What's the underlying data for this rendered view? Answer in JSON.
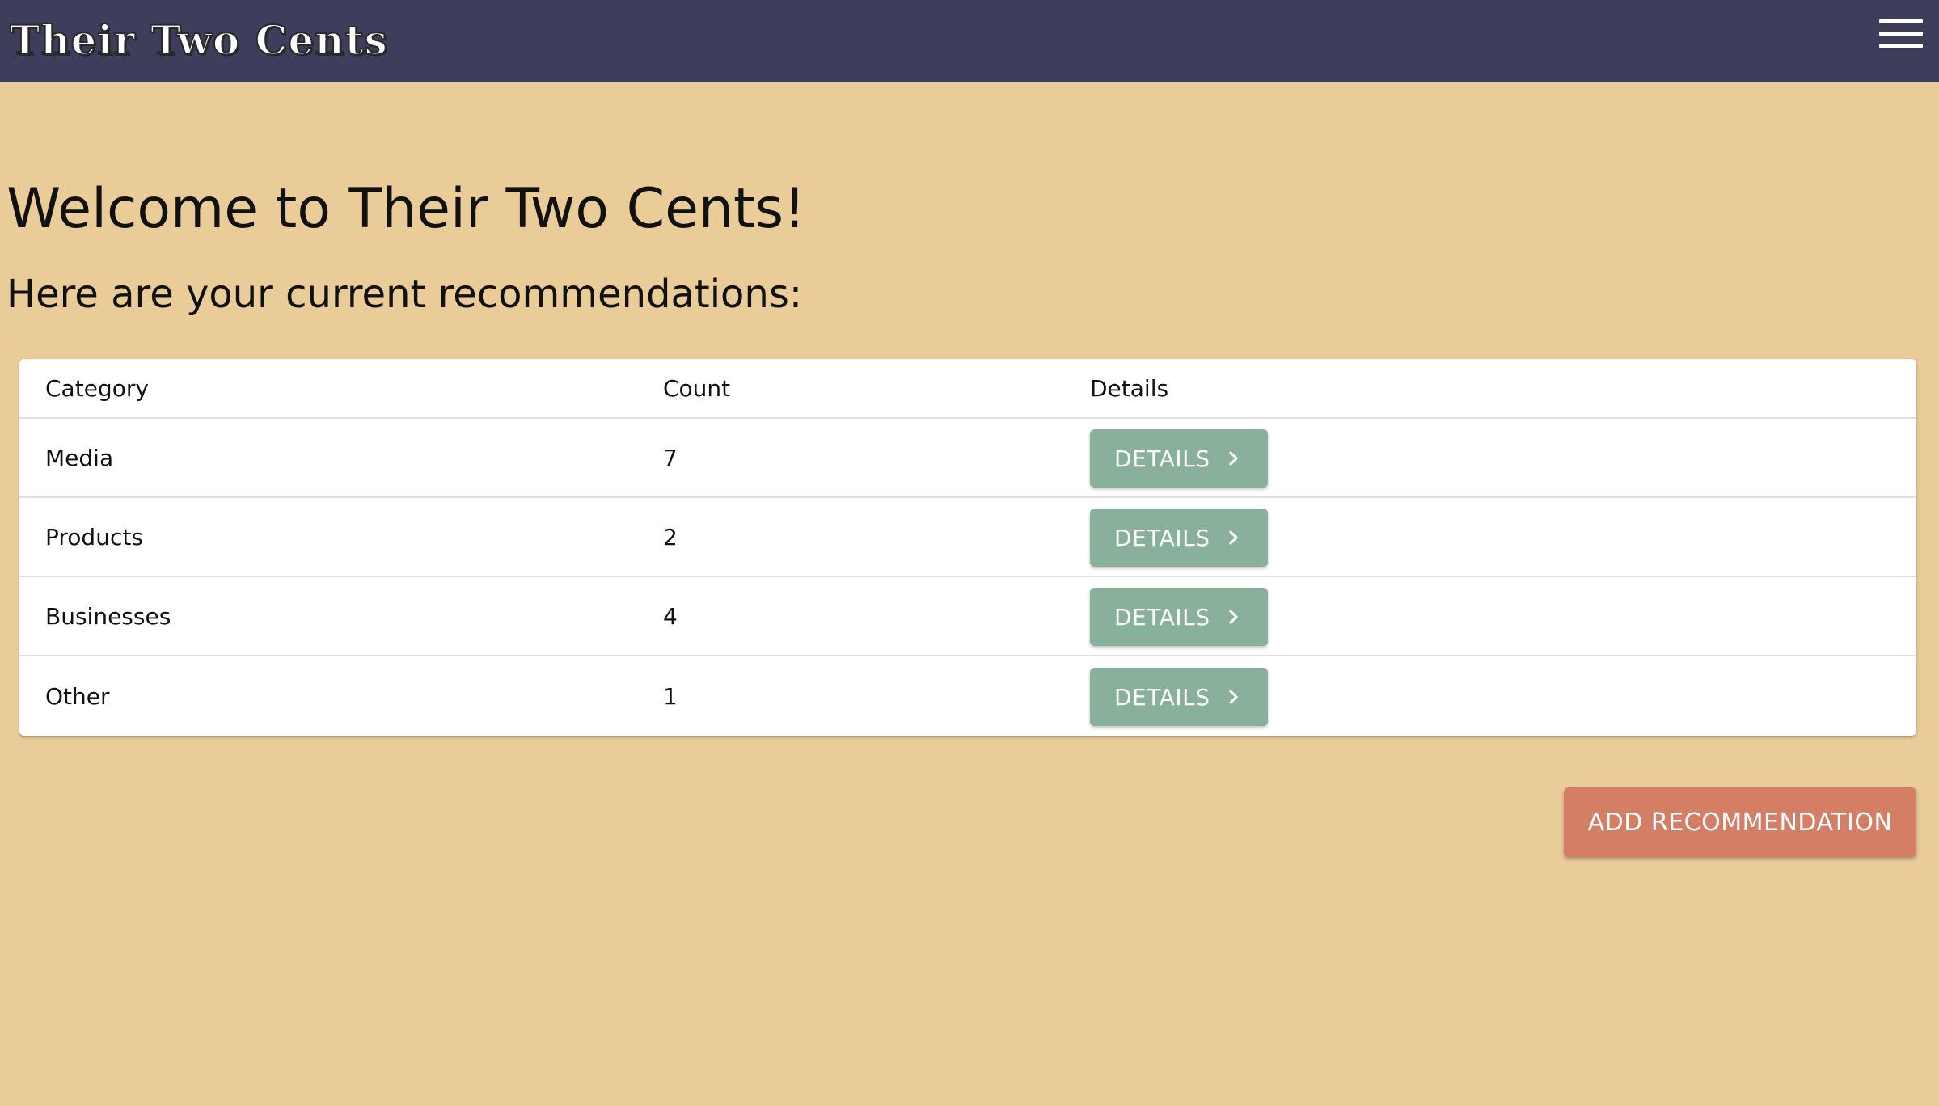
{
  "app": {
    "title": "Their Two Cents"
  },
  "header": {
    "menu_icon": "hamburger-menu-icon"
  },
  "main": {
    "heading": "Welcome to Their Two Cents!",
    "subheading": "Here are your current recommendations:",
    "table": {
      "columns": [
        "Category",
        "Count",
        "Details"
      ],
      "rows": [
        {
          "category": "Media",
          "count": "7",
          "details_label": "DETAILS"
        },
        {
          "category": "Products",
          "count": "2",
          "details_label": "DETAILS"
        },
        {
          "category": "Businesses",
          "count": "4",
          "details_label": "DETAILS"
        },
        {
          "category": "Other",
          "count": "1",
          "details_label": "DETAILS"
        }
      ]
    },
    "add_button_label": "ADD RECOMMENDATION"
  },
  "colors": {
    "topbar": "#3E3D5B",
    "background": "#EACC99",
    "details_button": "#89B09B",
    "add_button": "#D47F65"
  }
}
